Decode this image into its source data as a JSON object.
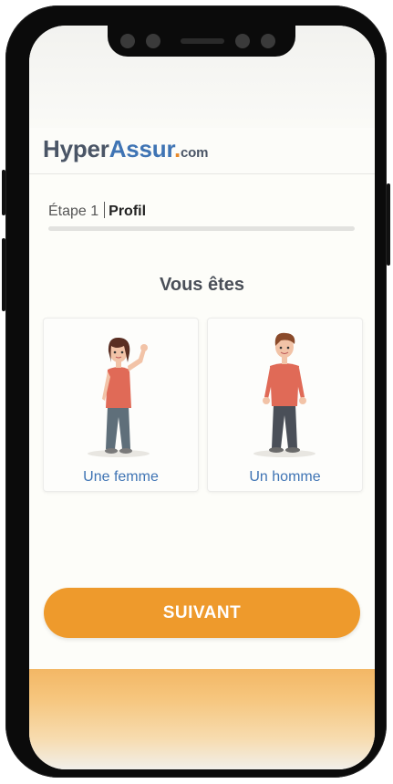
{
  "brand": {
    "hyper": "Hyper",
    "assur": "Assur",
    "dot": ".",
    "com": "com"
  },
  "step": {
    "label": "Étape 1",
    "name": "Profil",
    "progress": 0
  },
  "question": "Vous êtes",
  "options": [
    {
      "label": "Une femme",
      "icon": "woman-illustration-icon"
    },
    {
      "label": "Un homme",
      "icon": "man-illustration-icon"
    }
  ],
  "cta": {
    "label": "SUIVANT"
  },
  "colors": {
    "accent_blue": "#3f74b4",
    "accent_orange": "#ee9a2c",
    "text_dark": "#4a4f58"
  }
}
